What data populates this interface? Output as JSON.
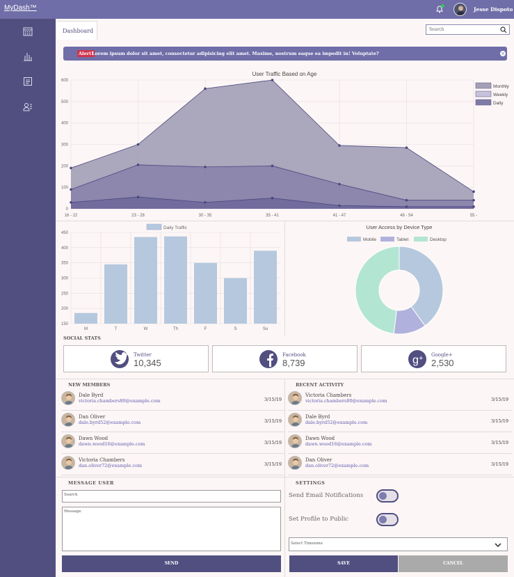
{
  "app": {
    "logo": "MyDash™"
  },
  "user": {
    "name": "Jesse Dispoto"
  },
  "tabs": {
    "active": "Dashboard"
  },
  "search": {
    "placeholder": "Search"
  },
  "alert": {
    "tag": "Alert!",
    "text": "Lorem ipsum dolor sit amet, consectetur adipisicing elit amet. Maxime, nostrum eaque ea impedit in! Voluptate?"
  },
  "sidebar": {
    "items": [
      "calendar-icon",
      "bar-chart-icon",
      "document-icon",
      "user-list-icon"
    ]
  },
  "colors": {
    "accent": "#6f6ea8",
    "sidebar": "#514e80",
    "alert_tag": "#d0344c"
  },
  "traffic_chart": {
    "title": "User Traffic Based on Age",
    "ylim": [
      0,
      600
    ],
    "yticks": [
      "0",
      "100",
      "200",
      "300",
      "400",
      "500",
      "600"
    ],
    "xticks": [
      "16 - 22",
      "23 - 28",
      "30 - 35",
      "35 - 41",
      "41 - 47",
      "48 - 54",
      "55 -"
    ]
  },
  "daily_chart": {
    "legend": "Daily Traffic",
    "yticks": [
      "150",
      "200",
      "250",
      "300",
      "350",
      "400",
      "450"
    ]
  },
  "device_chart": {
    "title": "User Access by Device Type"
  },
  "chart_data": [
    {
      "type": "area",
      "title": "User Traffic Based on Age",
      "categories": [
        "16 - 22",
        "23 - 28",
        "30 - 35",
        "35 - 41",
        "41 - 47",
        "48 - 54",
        "55 -"
      ],
      "ylim": [
        0,
        600
      ],
      "legend": "right",
      "series": [
        {
          "name": "Monthly",
          "color": "#a49fb6",
          "values": [
            190,
            300,
            560,
            600,
            295,
            285,
            80
          ]
        },
        {
          "name": "Weekly",
          "color": "#c7c2da",
          "values": [
            90,
            205,
            195,
            200,
            115,
            40,
            40
          ]
        },
        {
          "name": "Daily",
          "color": "#7e7aa6",
          "values": [
            30,
            55,
            30,
            50,
            15,
            10,
            10
          ]
        }
      ]
    },
    {
      "type": "bar",
      "categories": [
        "M",
        "T",
        "W",
        "Th",
        "F",
        "S",
        "Su"
      ],
      "ylim": [
        150,
        450
      ],
      "series": [
        {
          "name": "Daily Traffic",
          "color": "#b5c8de",
          "values": [
            185,
            345,
            435,
            437,
            350,
            300,
            390
          ]
        }
      ]
    },
    {
      "type": "pie",
      "title": "User Access by Device Type",
      "categories": [
        "Mobile",
        "Tablet",
        "Desktop"
      ],
      "values": [
        40,
        12,
        48
      ],
      "colors": [
        "#b5c8de",
        "#b1b1dd",
        "#b3e5d3"
      ]
    }
  ],
  "social": {
    "title": "SOCIAL STATS",
    "items": [
      {
        "name": "Twitter",
        "count": "10,345",
        "icon": "twitter-icon"
      },
      {
        "name": "Facebook",
        "count": "8,739",
        "icon": "facebook-icon"
      },
      {
        "name": "Google+",
        "count": "2,530",
        "icon": "google-plus-icon"
      }
    ]
  },
  "members": {
    "title": "NEW MEMBERS",
    "rows": [
      {
        "name": "Dale Byrd",
        "email": "victoria.chambers80@example.com",
        "date": "3/15/19"
      },
      {
        "name": "Dan Oliver",
        "email": "dale.byrd52@example.com",
        "date": "3/15/19"
      },
      {
        "name": "Dawn Wood",
        "email": "dawn.wood16@example.com",
        "date": "3/15/19"
      },
      {
        "name": "Victoria Chambers",
        "email": "dan.oliver72@example.com",
        "date": "3/15/19"
      }
    ]
  },
  "activity": {
    "title": "RECENT ACTIVITY",
    "rows": [
      {
        "name": "Victoria Chambers",
        "email": "victoria.chambers80@example.com",
        "date": "3/15/19"
      },
      {
        "name": "Dale Byrd",
        "email": "dale.byrd52@example.com",
        "date": "3/15/19"
      },
      {
        "name": "Dawn Wood",
        "email": "dawn.wood16@example.com",
        "date": "3/15/19"
      },
      {
        "name": "Dan Oliver",
        "email": "dan.oliver72@example.com",
        "date": "3/15/19"
      }
    ]
  },
  "message": {
    "title": "MESSAGE USER",
    "search_placeholder": "Search",
    "message_placeholder": "Message",
    "send_label": "SEND"
  },
  "settings": {
    "title": "SETTINGS",
    "email_label": "Send Email Notifications",
    "public_label": "Set Profile to Public",
    "timezone_placeholder": "Select Timezone",
    "save_label": "SAVE",
    "cancel_label": "CANCEL"
  }
}
